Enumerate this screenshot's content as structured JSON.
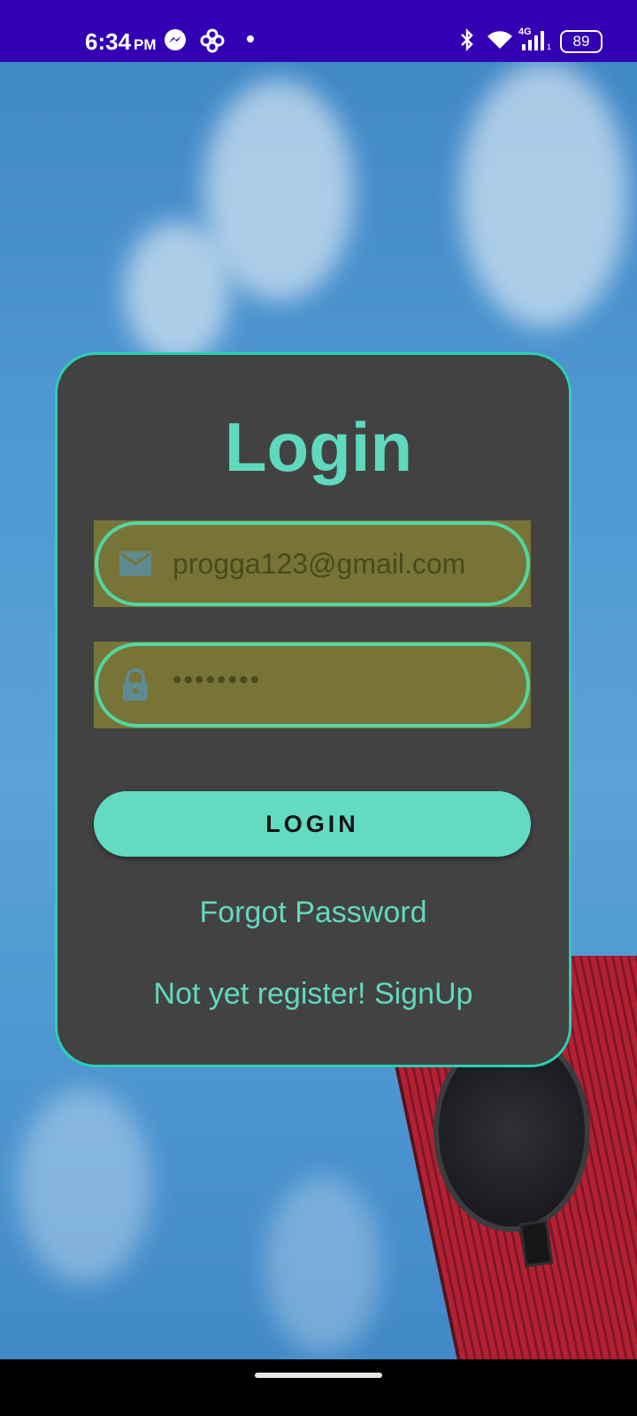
{
  "status_bar": {
    "time": "6:34",
    "ampm": "PM",
    "battery": "89",
    "network": "4G",
    "icons": [
      "messenger-icon",
      "pinwheel-icon",
      "dot-icon",
      "bluetooth-icon",
      "wifi-icon",
      "signal-icon",
      "battery-icon"
    ]
  },
  "login_card": {
    "title": "Login",
    "email": {
      "value": "progga123@gmail.com",
      "icon": "mail-icon"
    },
    "password": {
      "value": "••••••••",
      "icon": "lock-icon"
    },
    "login_button": "LOGIN",
    "forgot_password": "Forgot Password",
    "signup_link": "Not yet register! SignUp"
  },
  "colors": {
    "accent": "#5fd9bd",
    "card_background": "#424242",
    "field_background": "#787438",
    "field_border": "#51d7a0",
    "status_bar": "#3300b3"
  }
}
